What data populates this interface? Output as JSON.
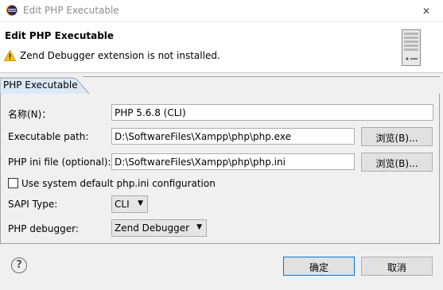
{
  "window": {
    "title": "Edit PHP Executable",
    "close_glyph": "✕"
  },
  "banner": {
    "title": "Edit PHP Executable",
    "warning": "Zend Debugger extension is not installed.",
    "icons": [
      "warning-icon",
      "server-icon"
    ]
  },
  "tab": {
    "label": "PHP Executable"
  },
  "form": {
    "name_label": "名称(N)：",
    "name_value": "PHP 5.6.8 (CLI)",
    "exe_label": "Executable path:",
    "exe_value": "D:\\SoftwareFiles\\Xampp\\php\\php.exe",
    "browse1": "浏览(B)...",
    "ini_label": "PHP ini file (optional):",
    "ini_value": "D:\\SoftwareFiles\\Xampp\\php\\php.ini",
    "browse2": "浏览(B)...",
    "checkbox_label": "Use system default php.ini configuration",
    "checkbox_checked": false,
    "sapi_label": "SAPI Type:",
    "sapi_value": "CLI",
    "debugger_label": "PHP debugger:",
    "debugger_value": "Zend Debugger",
    "dropdown_glyph": "▼"
  },
  "footer": {
    "help_glyph": "?",
    "ok": "确定",
    "cancel": "取消"
  }
}
